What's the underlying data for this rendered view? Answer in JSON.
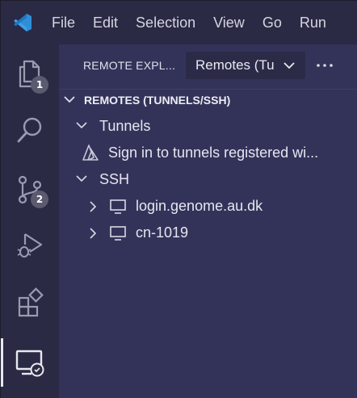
{
  "menu": [
    "File",
    "Edit",
    "Selection",
    "View",
    "Go",
    "Run"
  ],
  "activity_bar": {
    "explorer_badge": "1",
    "scm_badge": "2"
  },
  "sidebar": {
    "title": "REMOTE EXPL...",
    "dropdown_value": "Remotes (Tu",
    "section_title": "REMOTES (TUNNELS/SSH)",
    "tunnels_label": "Tunnels",
    "tunnels_signin": "Sign in to tunnels registered wi...",
    "ssh_label": "SSH",
    "hosts": [
      "login.genome.au.dk",
      "cn-1019"
    ]
  },
  "colors": {
    "accent": "#3c8fdc",
    "background": "#2f2f4d",
    "sidebar": "#33335a"
  }
}
